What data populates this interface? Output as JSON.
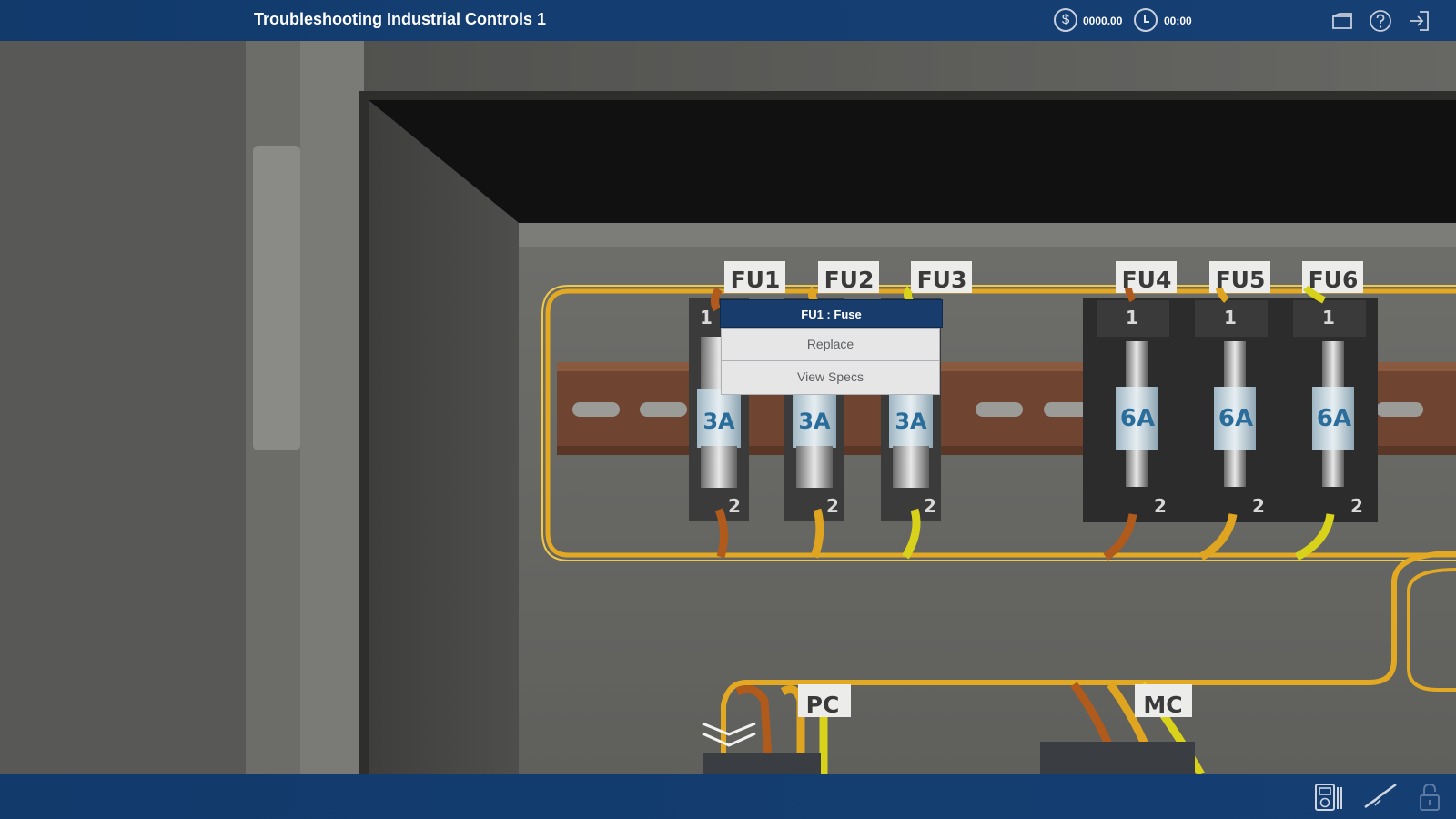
{
  "header": {
    "title": "Troubleshooting Industrial Controls 1",
    "money_icon": "$",
    "money_value": "0000.00",
    "timer_icon": "clock-icon",
    "timer_value": "00:00",
    "icons": [
      "folder-icon",
      "help-icon",
      "exit-icon"
    ]
  },
  "scene": {
    "fuse_labels": [
      "FU1",
      "FU2",
      "FU3",
      "FU4",
      "FU5",
      "FU6"
    ],
    "fuse_ratings": [
      "3A",
      "3A",
      "3A",
      "6A",
      "6A",
      "6A"
    ],
    "terminal_top": "1",
    "terminal_bottom": "2",
    "component_labels": [
      "PC",
      "MC"
    ]
  },
  "context_menu": {
    "title": "FU1 : Fuse",
    "items": [
      "Replace",
      "View Specs"
    ]
  },
  "footer": {
    "icons": [
      "multimeter-icon",
      "screwdriver-icon",
      "lock-icon"
    ]
  },
  "colors": {
    "header_bg": "#143e72",
    "menu_header_bg": "#183c6c",
    "menu_item_bg": "#e6e6e6",
    "wire_orange": "#e0a520",
    "wire_yellow": "#d8d21a",
    "wire_brown": "#b05a1c",
    "din_rail": "#7a4a32"
  }
}
